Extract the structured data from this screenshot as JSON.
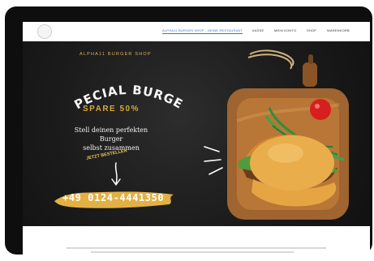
{
  "nav": {
    "items": [
      {
        "label": "ALPHA11 BURGER SHOP - DEINE RESTAURANT",
        "active": true
      },
      {
        "label": "KASSE",
        "active": false
      },
      {
        "label": "MEIN KONTO",
        "active": false
      },
      {
        "label": "SHOP",
        "active": false
      },
      {
        "label": "WARENKORB",
        "active": false
      }
    ]
  },
  "hero": {
    "shop_title": "ALPHA11 BURGER SHOP",
    "headline": "SPECIAL BURGER",
    "discount": "SPARE 50%",
    "tagline_line1": "Stell deinen perfekten Burger",
    "tagline_line2": "selbst zusammen",
    "order_cta": "JETZT BESTELLEN",
    "phone": "+49 0124-4441350"
  },
  "colors": {
    "accent_gold": "#d9a836",
    "nav_active": "#3d6fd8",
    "hero_bg": "#1b1b1b"
  }
}
